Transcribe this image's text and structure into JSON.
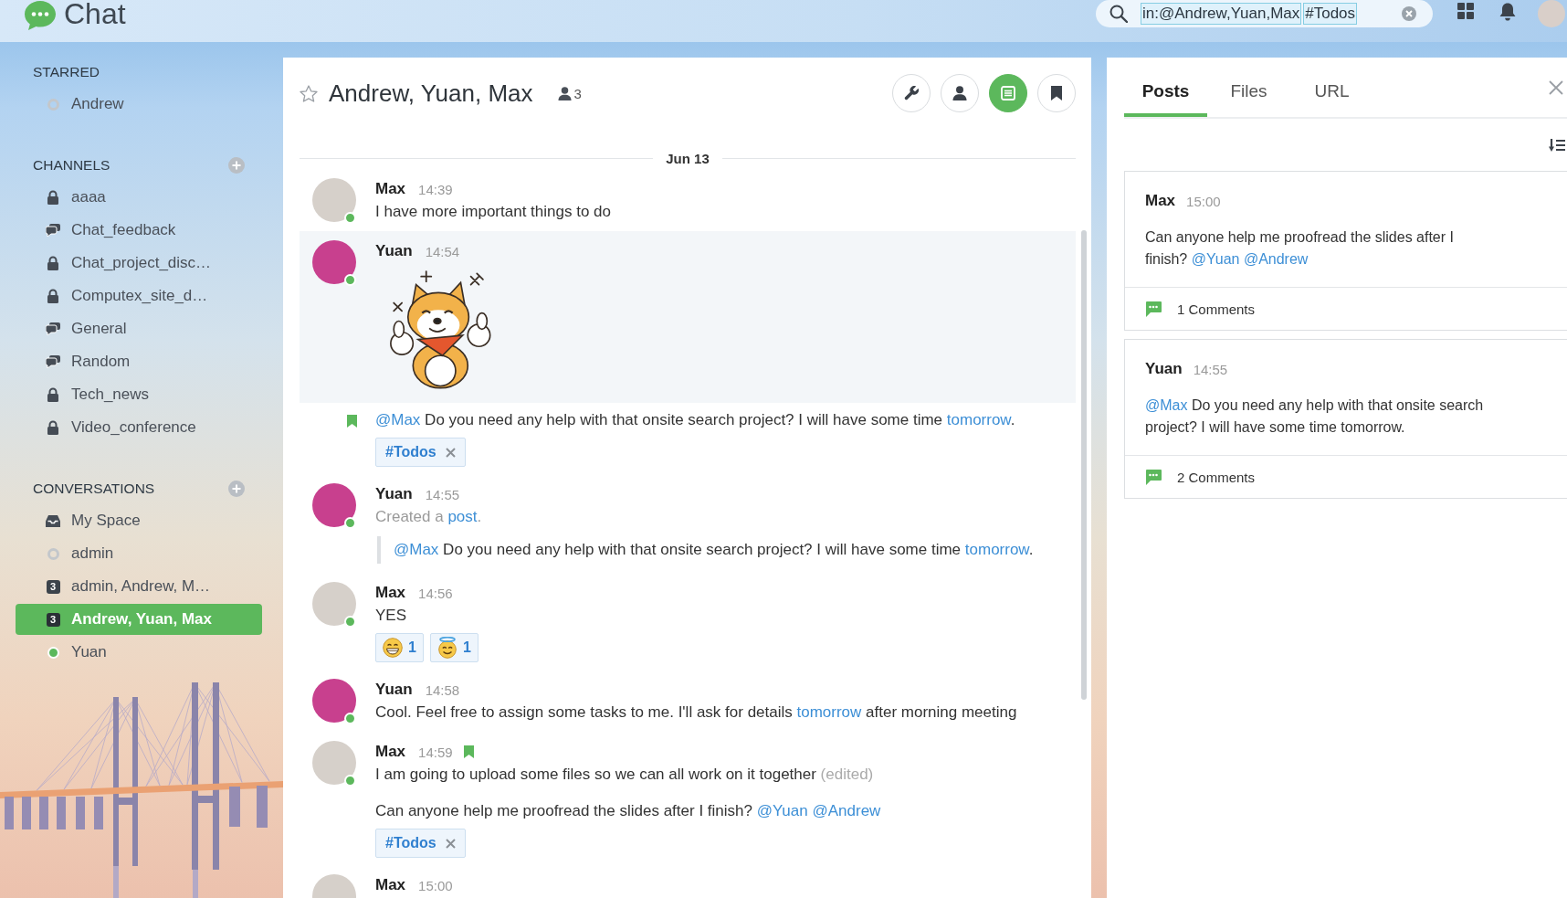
{
  "app": {
    "title": "Chat"
  },
  "search": {
    "tokens": [
      "in:@Andrew,Yuan,Max",
      "#Todos"
    ]
  },
  "sidebar": {
    "sections": [
      {
        "title": "STARRED",
        "addable": false,
        "items": [
          {
            "label": "Andrew",
            "kind": "person",
            "online": false,
            "selected": false
          }
        ]
      },
      {
        "title": "CHANNELS",
        "addable": true,
        "items": [
          {
            "label": "aaaa",
            "kind": "private",
            "selected": false
          },
          {
            "label": "Chat_feedback",
            "kind": "public",
            "selected": false
          },
          {
            "label": "Chat_project_disc…",
            "kind": "private",
            "selected": false
          },
          {
            "label": "Computex_site_d…",
            "kind": "private",
            "selected": false
          },
          {
            "label": "General",
            "kind": "public",
            "selected": false
          },
          {
            "label": "Random",
            "kind": "public",
            "selected": false
          },
          {
            "label": "Tech_news",
            "kind": "private",
            "selected": false
          },
          {
            "label": "Video_conference",
            "kind": "private",
            "selected": false
          }
        ]
      },
      {
        "title": "CONVERSATIONS",
        "addable": true,
        "items": [
          {
            "label": "My Space",
            "kind": "space",
            "selected": false
          },
          {
            "label": "admin",
            "kind": "person",
            "online": false,
            "selected": false
          },
          {
            "label": "admin, Andrew, M…",
            "kind": "group",
            "count": "3",
            "selected": false
          },
          {
            "label": "Andrew, Yuan, Max",
            "kind": "group",
            "count": "3",
            "selected": true
          },
          {
            "label": "Yuan",
            "kind": "person",
            "online": true,
            "selected": false
          }
        ]
      }
    ]
  },
  "conversation": {
    "starred": false,
    "title": "Andrew, Yuan, Max",
    "member_count": "3",
    "tools": [
      {
        "kind": "settings",
        "active": false
      },
      {
        "kind": "members",
        "active": false
      },
      {
        "kind": "posts",
        "active": true
      },
      {
        "kind": "bookmarks",
        "active": false
      }
    ],
    "date": "Jun 13",
    "groups": [
      {
        "author": "Max",
        "time": "14:39",
        "color": "#d6d0ca",
        "online": true,
        "messages": [
          {
            "kind": "text",
            "highlighted": false,
            "bookmarked": false,
            "segments": [
              {
                "kind": "plain",
                "text": "I have more important things to do"
              }
            ]
          }
        ]
      },
      {
        "author": "Yuan",
        "time": "14:54",
        "color": "#c8408e",
        "online": true,
        "messages": [
          {
            "kind": "sticker",
            "highlighted": true,
            "bookmarked": false
          },
          {
            "kind": "text",
            "highlighted": false,
            "bookmarked": true,
            "segments": [
              {
                "kind": "mention",
                "text": "@Max"
              },
              {
                "kind": "plain",
                "text": " Do you need any help with that onsite search project? I will have some time "
              },
              {
                "kind": "link",
                "text": "tomorrow"
              },
              {
                "kind": "plain",
                "text": "."
              }
            ],
            "tags": [
              "#Todos"
            ]
          }
        ]
      },
      {
        "author": "Yuan",
        "time": "14:55",
        "color": "#c8408e",
        "online": true,
        "messages": [
          {
            "kind": "text",
            "highlighted": false,
            "bookmarked": false,
            "segments": [
              {
                "kind": "system",
                "text": "Created a "
              },
              {
                "kind": "link",
                "text": "post"
              },
              {
                "kind": "system",
                "text": "."
              }
            ],
            "quote": [
              {
                "kind": "mention",
                "text": "@Max"
              },
              {
                "kind": "plain",
                "text": " Do you need any help with that onsite search project? I will have some time "
              },
              {
                "kind": "link",
                "text": "tomorrow"
              },
              {
                "kind": "plain",
                "text": "."
              }
            ]
          }
        ]
      },
      {
        "author": "Max",
        "time": "14:56",
        "color": "#d6d0ca",
        "online": true,
        "messages": [
          {
            "kind": "text",
            "highlighted": false,
            "bookmarked": false,
            "segments": [
              {
                "kind": "plain",
                "text": "YES"
              }
            ],
            "reactions": [
              {
                "kind": "grin",
                "count": "1"
              },
              {
                "kind": "halo",
                "count": "1"
              }
            ]
          }
        ]
      },
      {
        "author": "Yuan",
        "time": "14:58",
        "color": "#c8408e",
        "online": true,
        "messages": [
          {
            "kind": "text",
            "highlighted": false,
            "bookmarked": false,
            "segments": [
              {
                "kind": "plain",
                "text": "Cool. Feel free to assign some tasks to me. I'll ask for details "
              },
              {
                "kind": "link",
                "text": "tomorrow"
              },
              {
                "kind": "plain",
                "text": " after morning meeting"
              }
            ]
          }
        ]
      },
      {
        "author": "Max",
        "time": "14:59",
        "color": "#d6d0ca",
        "online": true,
        "messages": [
          {
            "kind": "text",
            "highlighted": false,
            "bookmarked": true,
            "segments": [
              {
                "kind": "plain",
                "text": "I am going to upload some files so we can all work on it together "
              },
              {
                "kind": "note",
                "text": "(edited)"
              }
            ]
          },
          {
            "kind": "text",
            "highlighted": false,
            "bookmarked": false,
            "segments": [
              {
                "kind": "plain",
                "text": "Can anyone help me proofread the slides after I finish? "
              },
              {
                "kind": "mention",
                "text": "@Yuan"
              },
              {
                "kind": "mention",
                "text": "@Andrew"
              }
            ],
            "tags": [
              "#Todos"
            ]
          }
        ]
      },
      {
        "author": "Max",
        "time": "15:00",
        "color": "#d6d0ca"
      }
    ]
  },
  "side_panel": {
    "tabs": [
      {
        "label": "Posts",
        "selected": true
      },
      {
        "label": "Files",
        "selected": false
      },
      {
        "label": "URL",
        "selected": false
      }
    ],
    "posts": [
      {
        "author": "Max",
        "time": "15:00",
        "segments": [
          {
            "kind": "plain",
            "text": "Can anyone help me proofread the slides after I finish? "
          },
          {
            "kind": "mention",
            "text": "@Yuan"
          },
          {
            "kind": "mention",
            "text": "@Andrew"
          }
        ],
        "comments": "1 Comments"
      },
      {
        "author": "Yuan",
        "time": "14:55",
        "segments": [
          {
            "kind": "mention",
            "text": "@Max"
          },
          {
            "kind": "plain",
            "text": " Do you need any help with that onsite search project? I will have some time tomorrow."
          }
        ],
        "comments": "2 Comments"
      }
    ]
  }
}
